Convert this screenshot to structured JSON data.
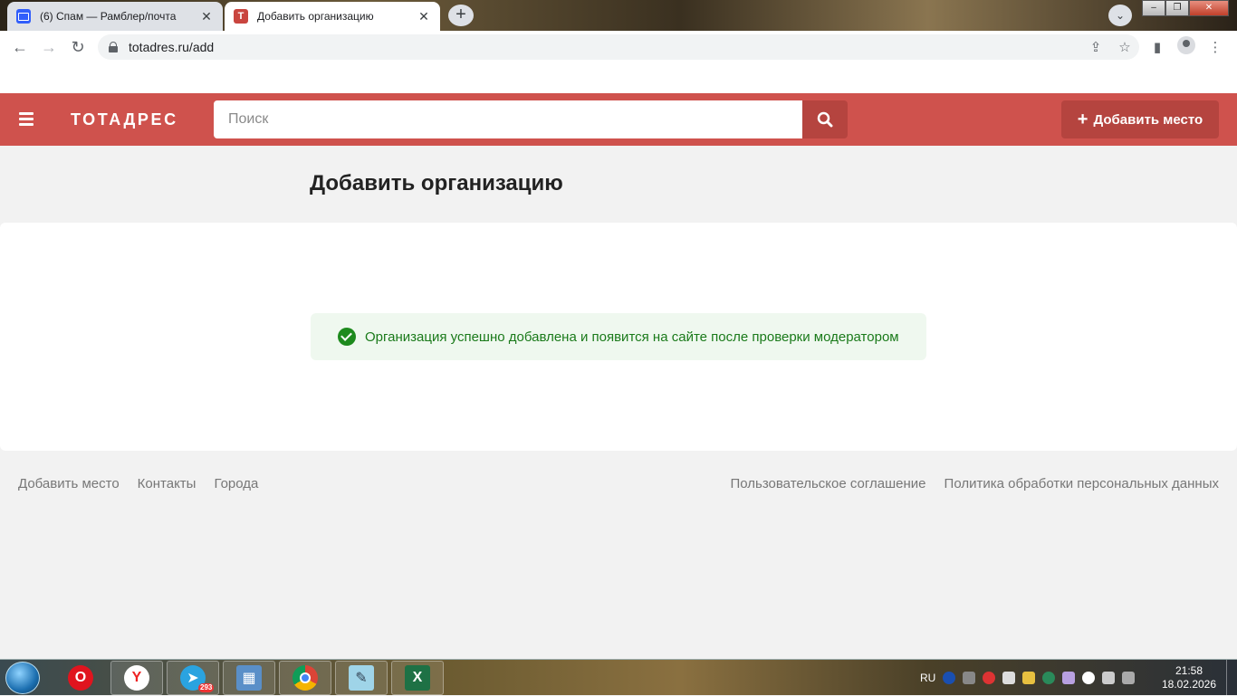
{
  "browser": {
    "tabs": [
      {
        "title": "(6) Спам — Рамблер/почта",
        "icon": "mail-icon"
      },
      {
        "title": "Добавить организацию",
        "icon": "t-icon"
      }
    ],
    "close_glyph": "✕",
    "new_tab_glyph": "+",
    "url": "totadres.ru/add"
  },
  "site": {
    "logo": "ТОТАДРЕС",
    "search_placeholder": "Поиск",
    "add_place_button": "Добавить место",
    "add_place_plus": "+",
    "page_title": "Добавить организацию",
    "success_message": "Организация успешно добавлена и появится на сайте после проверки модератором",
    "footer": {
      "left": [
        "Добавить место",
        "Контакты",
        "Города"
      ],
      "right": [
        "Пользовательское соглашение",
        "Политика обработки персональных данных"
      ]
    },
    "colors": {
      "header": "#cf524d",
      "button": "#b5443f",
      "success_text": "#1a7a1a",
      "success_bg": "#eff8ef"
    }
  },
  "taskbar": {
    "telegram_badge": "293",
    "language": "RU",
    "time": "21:58",
    "date": "18.02.2026"
  }
}
